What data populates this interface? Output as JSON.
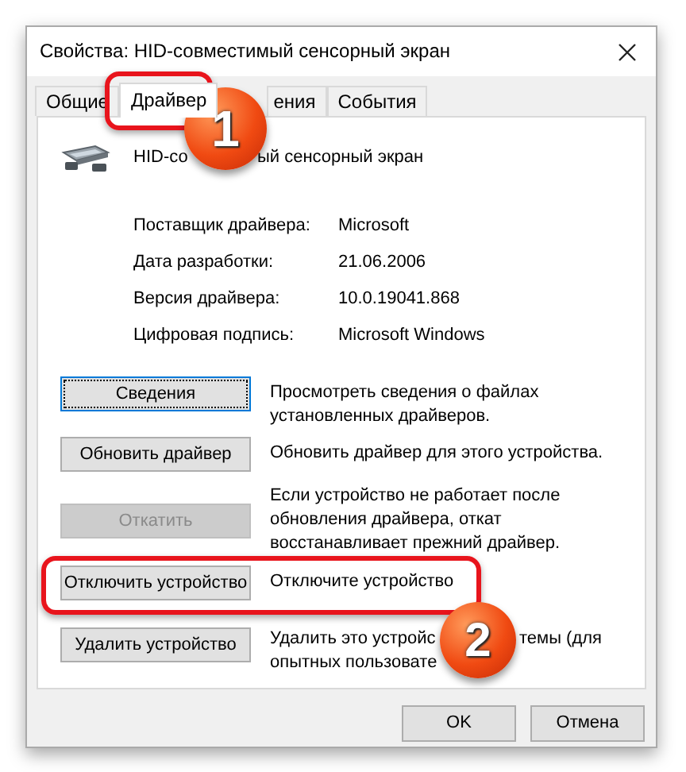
{
  "window": {
    "title": "Свойства: HID-совместимый сенсорный экран"
  },
  "tabs": [
    {
      "label": "Общие",
      "selected": false
    },
    {
      "label": "Драйвер",
      "selected": true
    },
    {
      "label": "ения",
      "selected": false
    },
    {
      "label": "События",
      "selected": false
    }
  ],
  "device": {
    "name_parts": [
      "HID-со",
      "ый сенсорный экран"
    ]
  },
  "properties": [
    {
      "label": "Поставщик драйвера:",
      "value": "Microsoft"
    },
    {
      "label": "Дата разработки:",
      "value": "21.06.2006"
    },
    {
      "label": "Версия драйвера:",
      "value": "10.0.19041.868"
    },
    {
      "label": "Цифровая подпись:",
      "value": "Microsoft Windows"
    }
  ],
  "actions": [
    {
      "label": "Сведения",
      "focused": true,
      "disabled": false,
      "description": [
        [
          "Просмотреть сведения о файлах"
        ],
        [
          "установленных драйверов."
        ]
      ]
    },
    {
      "label": "Обновить драйвер",
      "focused": false,
      "disabled": false,
      "description": [
        [
          "Обновить драйвер для этого устройства."
        ]
      ]
    },
    {
      "label": "Откатить",
      "focused": false,
      "disabled": true,
      "description": [
        [
          "Если устройство не работает после"
        ],
        [
          "обновления драйвера, откат"
        ],
        [
          "восстанавливает прежний драйвер."
        ]
      ]
    },
    {
      "label": "Отключить устройство",
      "focused": false,
      "disabled": false,
      "description": [
        [
          "Отключите устройство"
        ]
      ]
    },
    {
      "label": "Удалить устройство",
      "focused": false,
      "disabled": false,
      "description": [
        [
          "Удалить это устройс",
          "темы (для"
        ],
        [
          "опытных пользовате"
        ]
      ]
    }
  ],
  "dialog_buttons": [
    "OK",
    "Отмена"
  ],
  "callouts": [
    {
      "number": "1"
    },
    {
      "number": "2"
    }
  ]
}
